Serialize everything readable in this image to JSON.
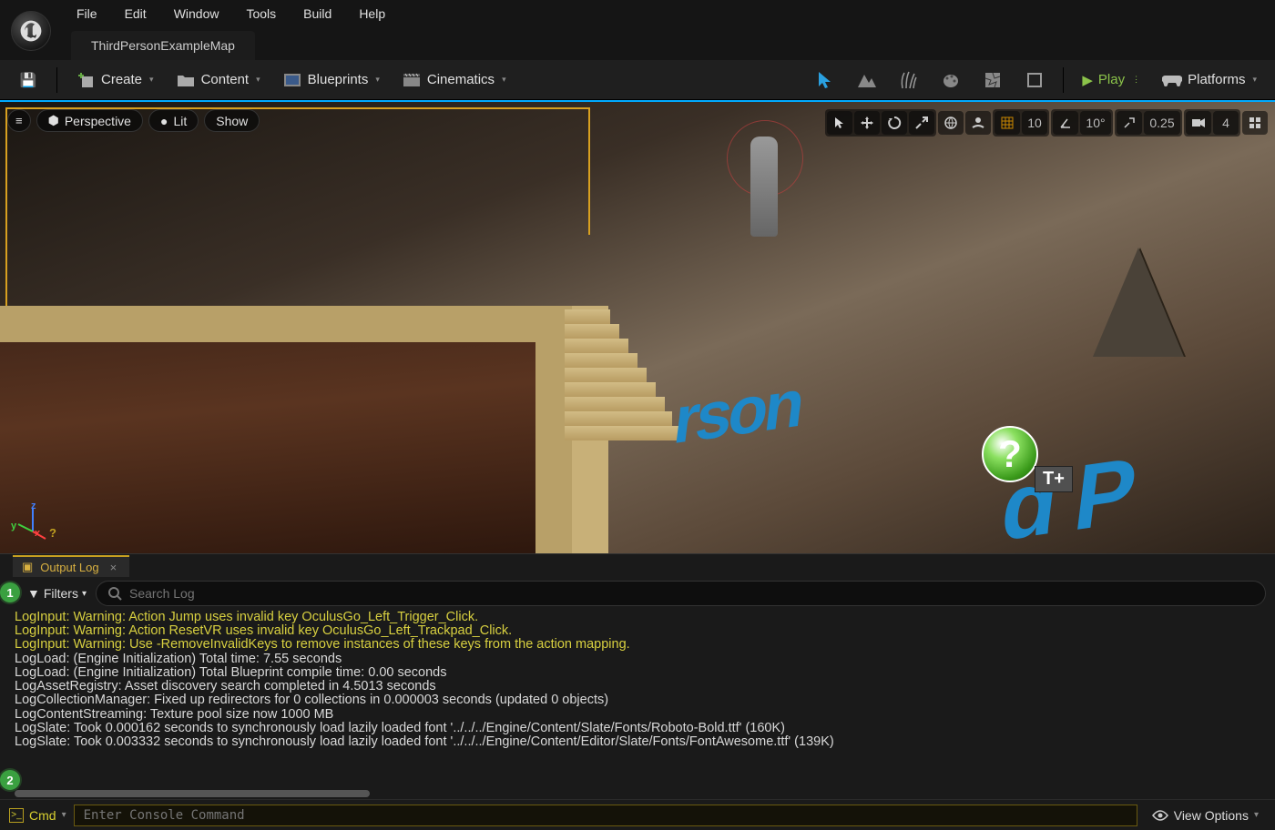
{
  "menu": {
    "items": [
      "File",
      "Edit",
      "Window",
      "Tools",
      "Build",
      "Help"
    ]
  },
  "tab": {
    "title": "ThirdPersonExampleMap"
  },
  "toolbar": {
    "create": "Create",
    "content": "Content",
    "blueprints": "Blueprints",
    "cinematics": "Cinematics",
    "play": "Play",
    "platforms": "Platforms"
  },
  "viewport": {
    "menu": "≡",
    "perspective": "Perspective",
    "lit": "Lit",
    "show": "Show",
    "grid_snap": "10",
    "angle_snap": "10°",
    "scale_snap": "0.25",
    "camera_speed": "4",
    "text3d_a": "rson",
    "text3d_b": "d P",
    "help": "?",
    "tplus": "T+"
  },
  "log": {
    "title": "Output Log",
    "filters": "Filters",
    "search_placeholder": "Search Log",
    "lines": [
      {
        "cls": "warn",
        "t": "LogInput: Warning: Action Jump uses invalid key OculusGo_Left_Trigger_Click."
      },
      {
        "cls": "warn",
        "t": "LogInput: Warning: Action ResetVR uses invalid key OculusGo_Left_Trackpad_Click."
      },
      {
        "cls": "warn",
        "t": "LogInput: Warning: Use -RemoveInvalidKeys to remove instances of these keys from the action mapping."
      },
      {
        "cls": "norm",
        "t": "LogLoad: (Engine Initialization) Total time: 7.55 seconds"
      },
      {
        "cls": "norm",
        "t": "LogLoad: (Engine Initialization) Total Blueprint compile time: 0.00 seconds"
      },
      {
        "cls": "norm",
        "t": "LogAssetRegistry: Asset discovery search completed in 4.5013 seconds"
      },
      {
        "cls": "norm",
        "t": "LogCollectionManager: Fixed up redirectors for 0 collections in 0.000003 seconds (updated 0 objects)"
      },
      {
        "cls": "norm",
        "t": "LogContentStreaming: Texture pool size now 1000 MB"
      },
      {
        "cls": "norm",
        "t": "LogSlate: Took 0.000162 seconds to synchronously load lazily loaded font '../../../Engine/Content/Slate/Fonts/Roboto-Bold.ttf' (160K)"
      },
      {
        "cls": "norm",
        "t": "LogSlate: Took 0.003332 seconds to synchronously load lazily loaded font '../../../Engine/Content/Editor/Slate/Fonts/FontAwesome.ttf' (139K)"
      }
    ],
    "cmd_label": "Cmd",
    "cmd_placeholder": "Enter Console Command",
    "view_options": "View Options"
  },
  "callouts": {
    "c1": "1",
    "c2": "2"
  }
}
